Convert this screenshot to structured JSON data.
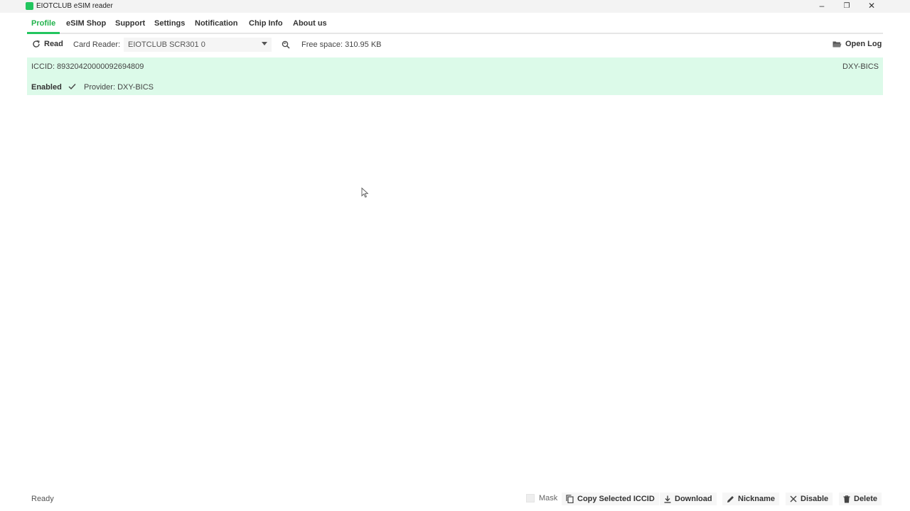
{
  "window": {
    "title": "EIOTCLUB eSIM reader"
  },
  "tabs": [
    "Profile",
    "eSIM Shop",
    "Support",
    "Settings",
    "Notification",
    "Chip Info",
    "About us"
  ],
  "toolbar": {
    "read_label": "Read",
    "card_reader_label": "Card Reader:",
    "card_reader_value": "EIOTCLUB SCR301 0",
    "free_space": "Free space: 310.95 KB",
    "open_log_label": "Open Log"
  },
  "profile": {
    "iccid": "ICCID: 89320420000092694809",
    "name": "DXY-BICS",
    "state": "Enabled",
    "provider": "Provider: DXY-BICS"
  },
  "statusbar": {
    "status": "Ready",
    "mask_label": "Mask",
    "copy_label": "Copy Selected ICCID",
    "download_label": "Download",
    "nickname_label": "Nickname",
    "disable_label": "Disable",
    "delete_label": "Delete"
  },
  "colors": {
    "accent": "#22c55e",
    "profile_bg": "#dcfae9"
  }
}
